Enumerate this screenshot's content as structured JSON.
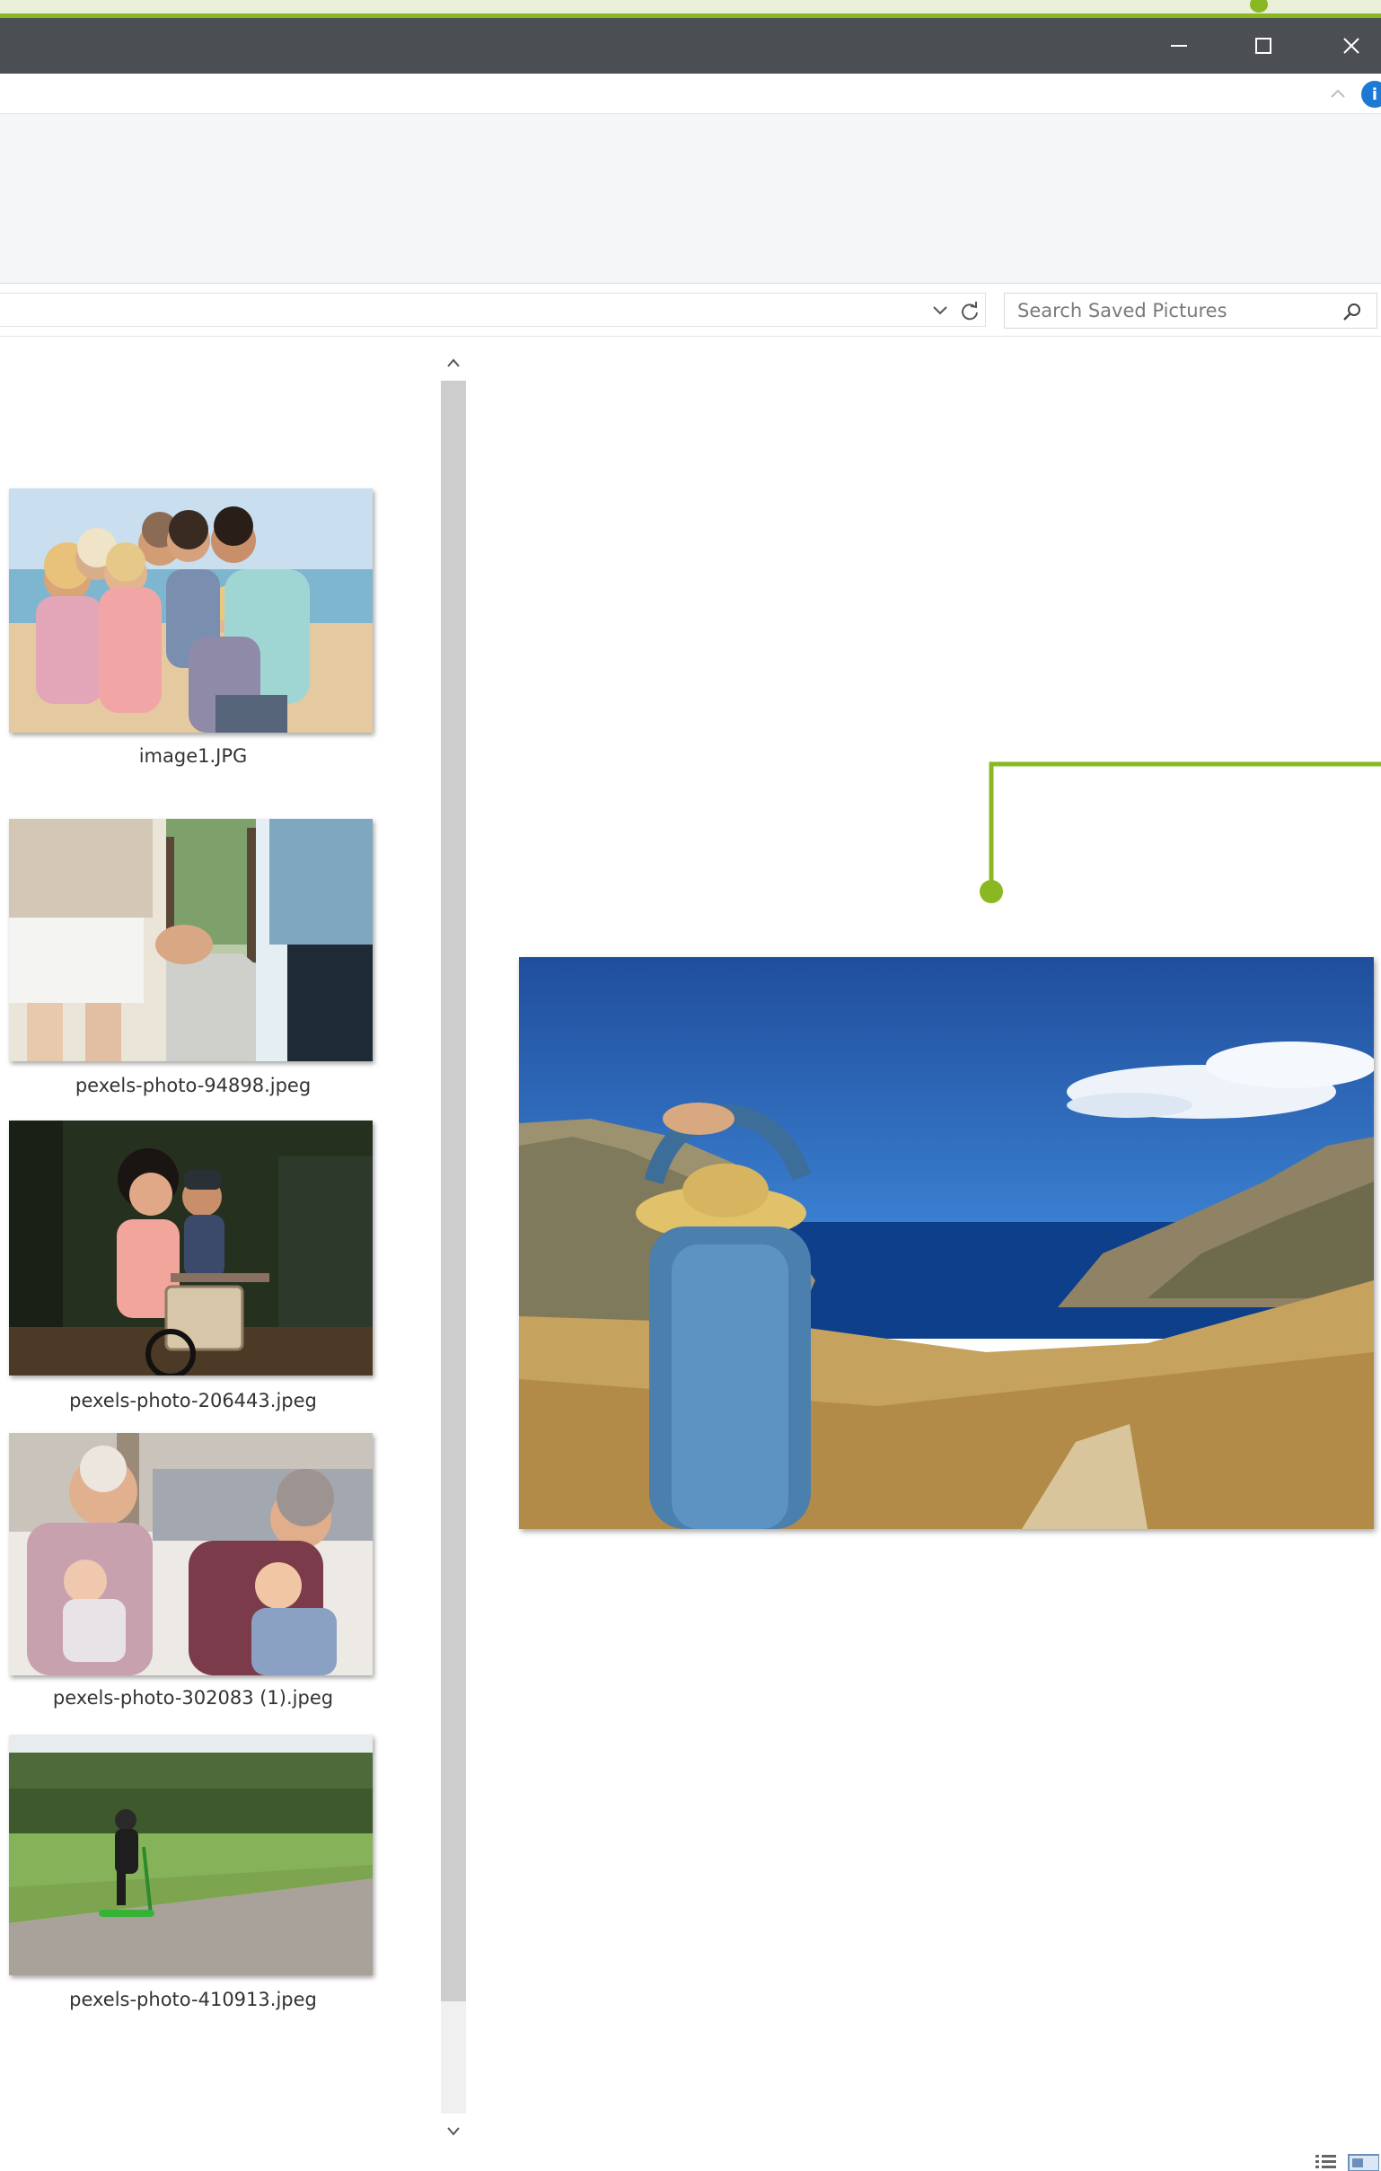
{
  "window": {
    "title_controls": {
      "minimize": "minimize",
      "maximize": "maximize",
      "close": "close"
    }
  },
  "search": {
    "placeholder": "Search Saved Pictures"
  },
  "files": [
    {
      "name": "image1.JPG"
    },
    {
      "name": "pexels-photo-94898.jpeg"
    },
    {
      "name": "pexels-photo-206443.jpeg"
    },
    {
      "name": "pexels-photo-302083 (1).jpeg"
    },
    {
      "name": "pexels-photo-410913.jpeg"
    }
  ],
  "colors": {
    "accent": "#8ab822",
    "titlebar": "#4b4f54",
    "help": "#1d79d4"
  },
  "icons": {
    "help": "i",
    "search": "search-icon",
    "refresh": "refresh-icon",
    "dropdown": "chevron-down-icon"
  }
}
